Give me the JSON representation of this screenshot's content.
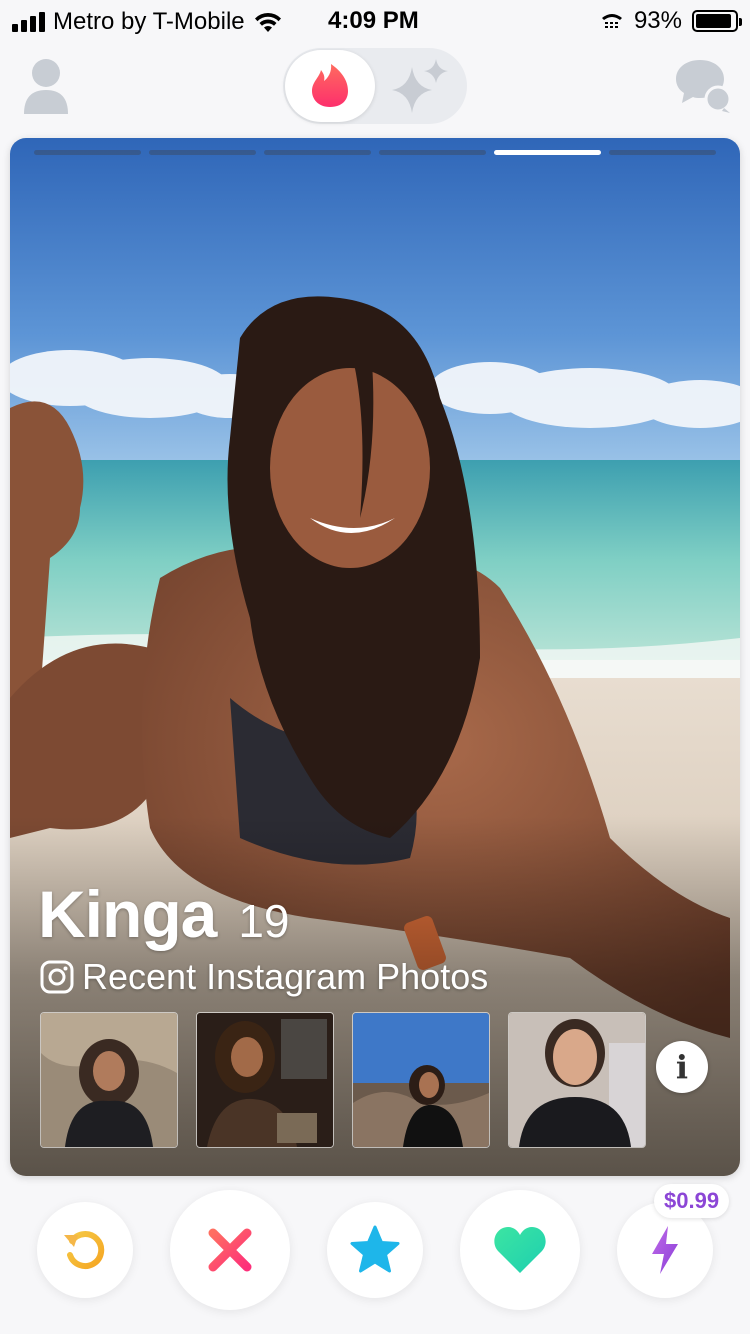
{
  "status_bar": {
    "carrier": "Metro by T-Mobile",
    "time": "4:09 PM",
    "battery_percent": "93%",
    "battery_level": 0.93
  },
  "top_nav": {
    "profile_icon": "person-icon",
    "flame_icon": "flame-icon",
    "sparkle_icon": "sparkle-icon",
    "chat_icon": "chat-bubbles-icon"
  },
  "card": {
    "name": "Kinga",
    "age": "19",
    "photo_count": 6,
    "active_photo_index": 4,
    "instagram_label": "Recent Instagram Photos",
    "instagram_icon": "instagram-icon",
    "info_label": "i",
    "thumbnails": [
      {
        "description_icon": "photo-thumbnail"
      },
      {
        "description_icon": "photo-thumbnail"
      },
      {
        "description_icon": "photo-thumbnail"
      },
      {
        "description_icon": "photo-thumbnail"
      }
    ]
  },
  "actions": {
    "rewind_icon": "rewind-icon",
    "nope_icon": "x-icon",
    "super_like_icon": "star-icon",
    "like_icon": "heart-icon",
    "boost_icon": "lightning-icon",
    "boost_price": "$0.99"
  },
  "colors": {
    "brand_red": "#fd5068",
    "rewind_yellow": "#f5b748",
    "super_like_blue": "#1eb6ea",
    "like_green": "#29e6a6",
    "boost_purple": "#a95ee8"
  }
}
